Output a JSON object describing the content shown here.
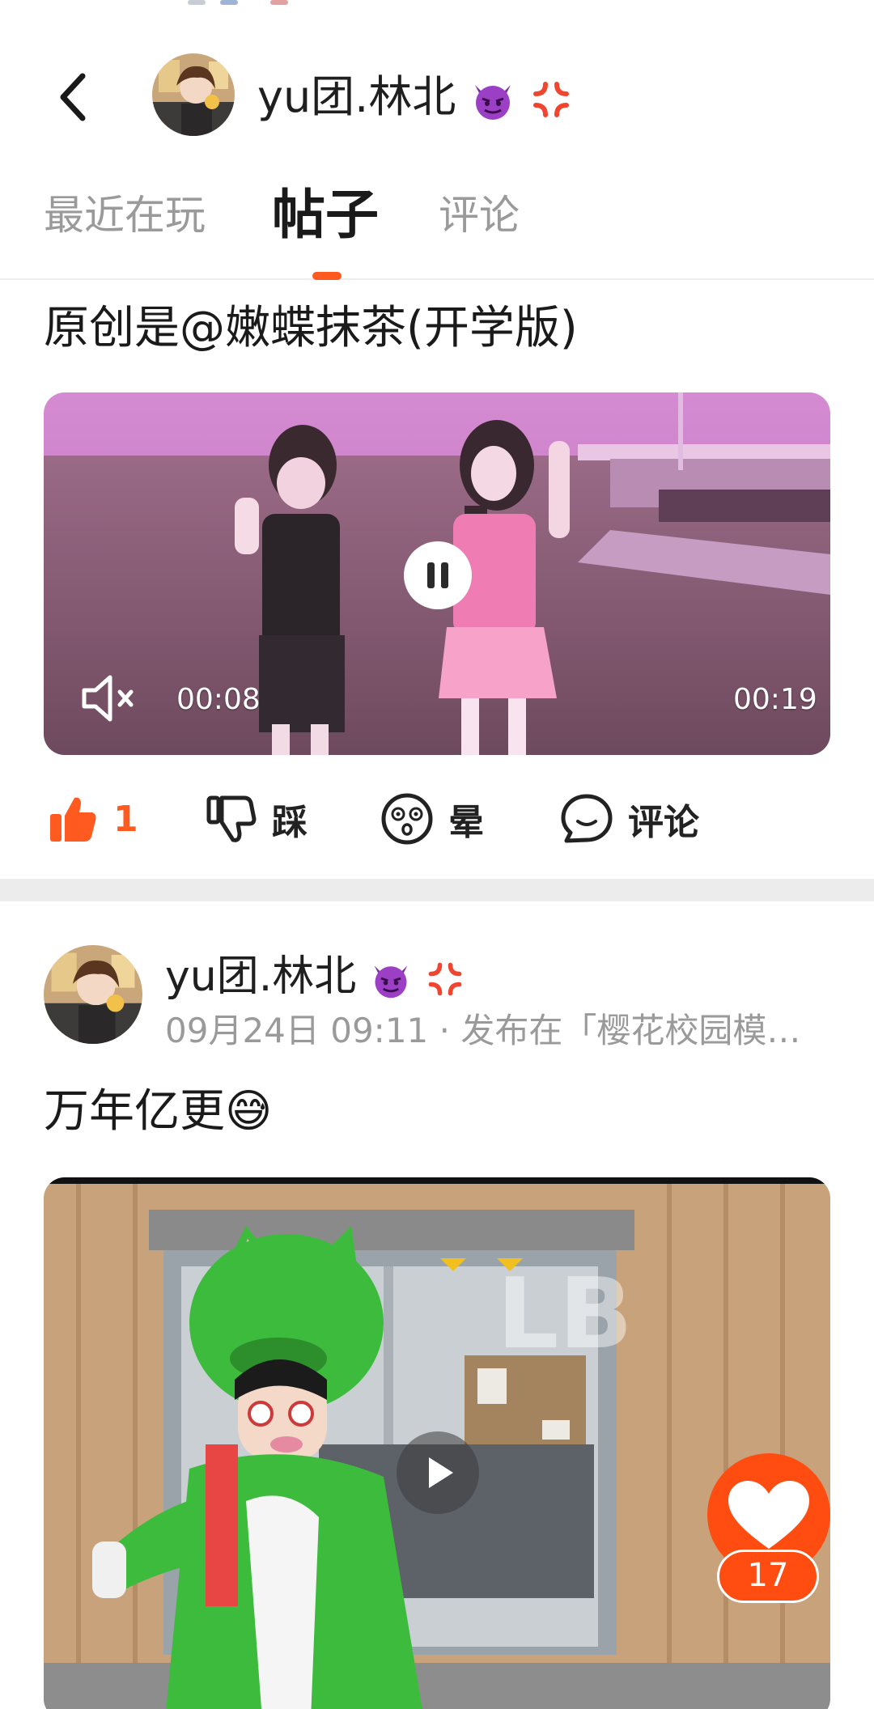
{
  "header": {
    "back_icon": "chevron-left-icon",
    "user_name": "yu团.林北",
    "name_emojis": [
      "devil-face-icon",
      "anger-symbol-icon"
    ]
  },
  "tabs": [
    {
      "label": "最近在玩",
      "active": false
    },
    {
      "label": "帖子",
      "active": true
    },
    {
      "label": "评论",
      "active": false
    }
  ],
  "post1": {
    "title": "原创是@嫩蝶抹茶(开学版)",
    "video": {
      "current_time": "00:08",
      "duration": "00:19",
      "state": "playing",
      "muted": true
    },
    "actions": {
      "like_count": "1",
      "dislike_label": "踩",
      "dizzy_label": "晕",
      "comment_label": "评论"
    }
  },
  "post2": {
    "author": "yu团.林北",
    "meta": "09月24日 09:11 · 发布在「樱花校园模…",
    "title": "万年亿更😅",
    "video": {
      "state": "paused",
      "watermark": "LB"
    }
  },
  "fab": {
    "icon": "heart-icon",
    "count": "17"
  },
  "colors": {
    "accent": "#ff5a1f",
    "fab": "#ff4d12",
    "muted_text": "#9a9a9a"
  }
}
